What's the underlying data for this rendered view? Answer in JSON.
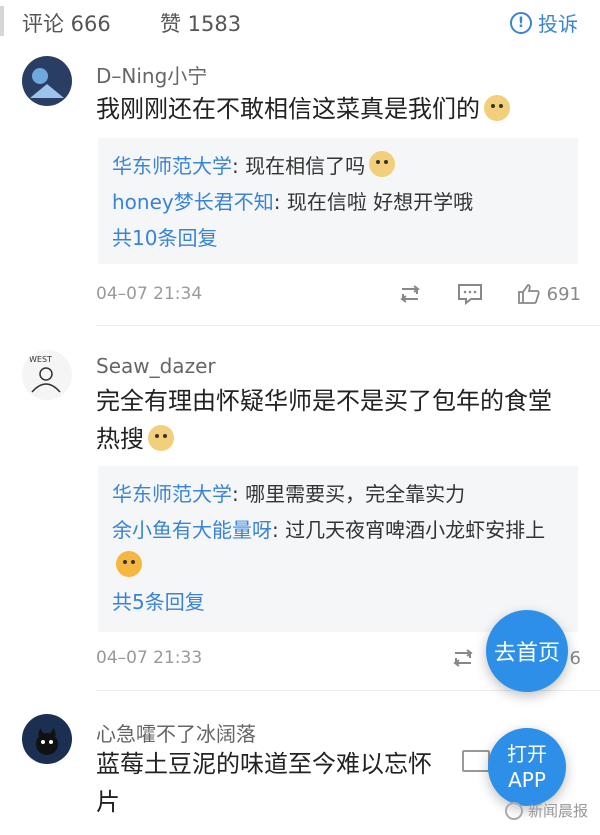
{
  "header": {
    "comments_tab": "评论 666",
    "likes_tab": "赞 1583",
    "report_label": "投诉",
    "report_icon": "info-icon"
  },
  "comments": [
    {
      "user": "D–Ning小宁",
      "text": "我刚刚还在不敢相信这菜真是我们的",
      "replies": [
        {
          "name": "华东师范大学",
          "text": ": 现在相信了吗"
        },
        {
          "name": "honey梦长君不知",
          "text": ": 现在信啦 好想开学哦"
        }
      ],
      "more": "共10条回复",
      "time": "04–07 21:34",
      "likes": "691"
    },
    {
      "user": "Seaw_dazer",
      "text": "完全有理由怀疑华师是不是买了包年的食堂热搜",
      "replies": [
        {
          "name": "华东师范大学",
          "text": ": 哪里需要买，完全靠实力"
        },
        {
          "name": "余小鱼有大能量呀",
          "text": ": 过几天夜宵啤酒小龙虾安排上"
        }
      ],
      "more": "共5条回复",
      "time": "04–07 21:33",
      "likes": "6"
    },
    {
      "user": "心急嚯不了冰阔落",
      "text": "蓝莓土豆泥的味道至今难以忘怀",
      "text_tail": "片"
    }
  ],
  "floating": {
    "home_label": "去首页",
    "app_line1": "打开",
    "app_line2": "APP"
  },
  "watermark": "新闻晨报",
  "colors": {
    "accent_blue": "#3a83d6",
    "fab_blue": "#2d8fe8",
    "reply_bg": "#f4f6f8"
  }
}
